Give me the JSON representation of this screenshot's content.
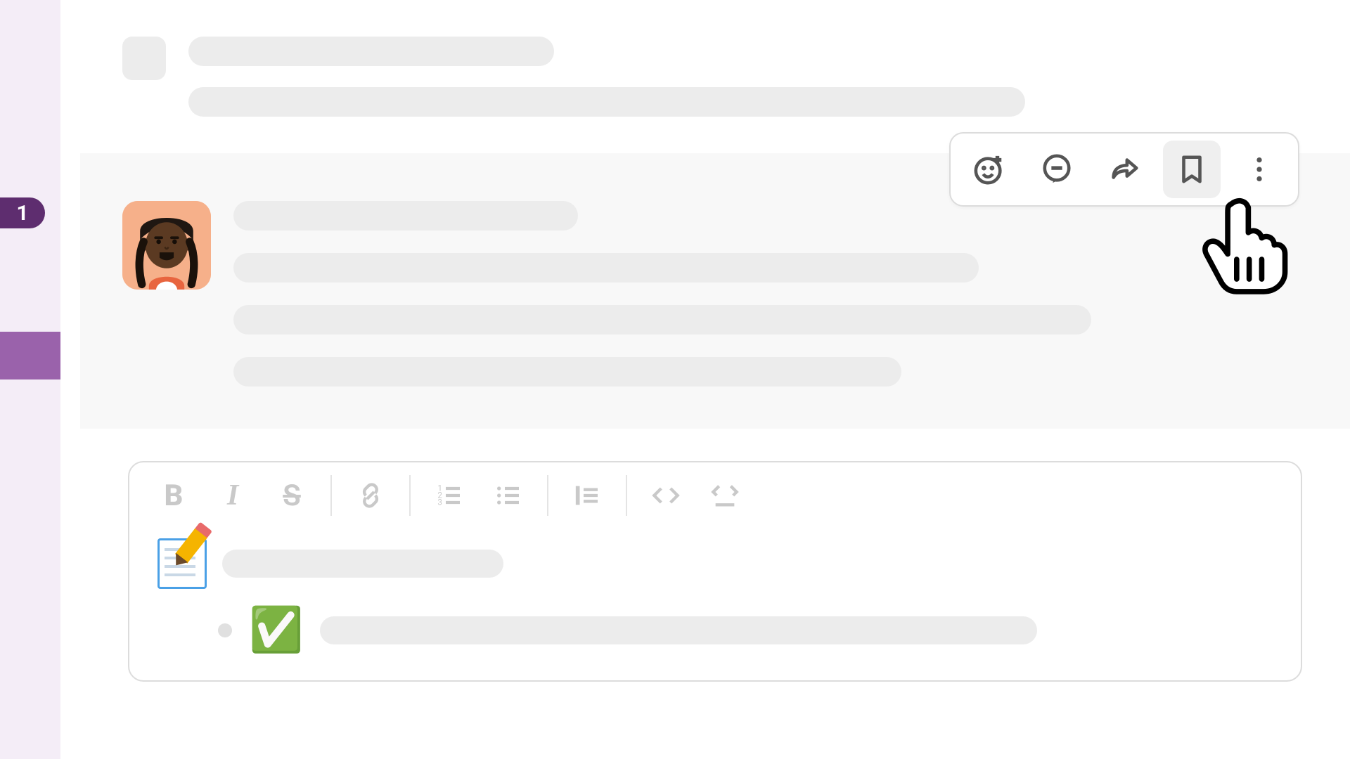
{
  "rail": {
    "badge_count": "1"
  },
  "message_actions": {
    "react": "add-reaction",
    "thread": "reply-in-thread",
    "share": "share-message",
    "bookmark": "save-bookmark",
    "more": "more-actions"
  },
  "composer": {
    "toolbar": {
      "bold": "B",
      "italic": "I",
      "strike": "S"
    },
    "content": {
      "memo_emoji": "memo",
      "check_emoji": "✅"
    }
  }
}
